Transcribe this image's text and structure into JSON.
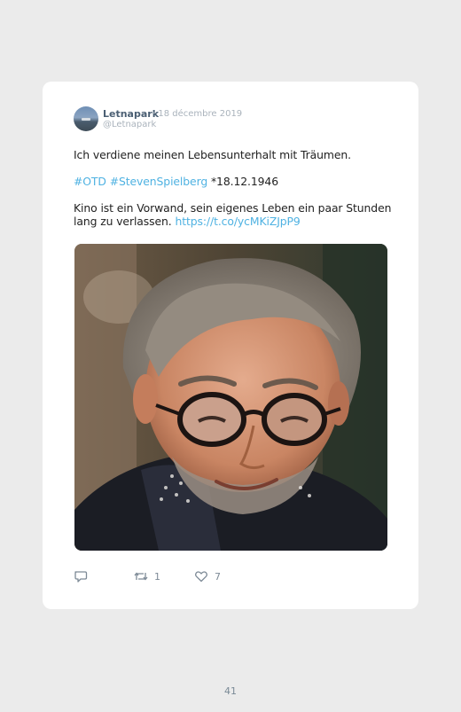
{
  "tweet": {
    "author_name": "Letnapark",
    "date": "· 18 décembre 2019",
    "handle": "@Letnapark",
    "line1": "Ich verdiene meinen Lebensunterhalt mit Träumen.",
    "hashtag1": "#OTD",
    "hashtag2": "#StevenSpielberg",
    "birth": "*18.12.1946",
    "para_line1": "Kino ist ein Vorwand, sein eigenes Leben ein paar Stunden",
    "para_line2_text": "lang zu verlassen.",
    "short_link": "https://t.co/ycMKiZJpP9",
    "retweet_count": "1",
    "like_count": "7"
  },
  "icons": {
    "reply": "reply-icon",
    "retweet": "retweet-icon",
    "like": "heart-icon"
  },
  "colors": {
    "link": "#4fb2e2",
    "card": "#ffffff",
    "page_background": "#ebebeb"
  },
  "page": {
    "number": "41"
  }
}
